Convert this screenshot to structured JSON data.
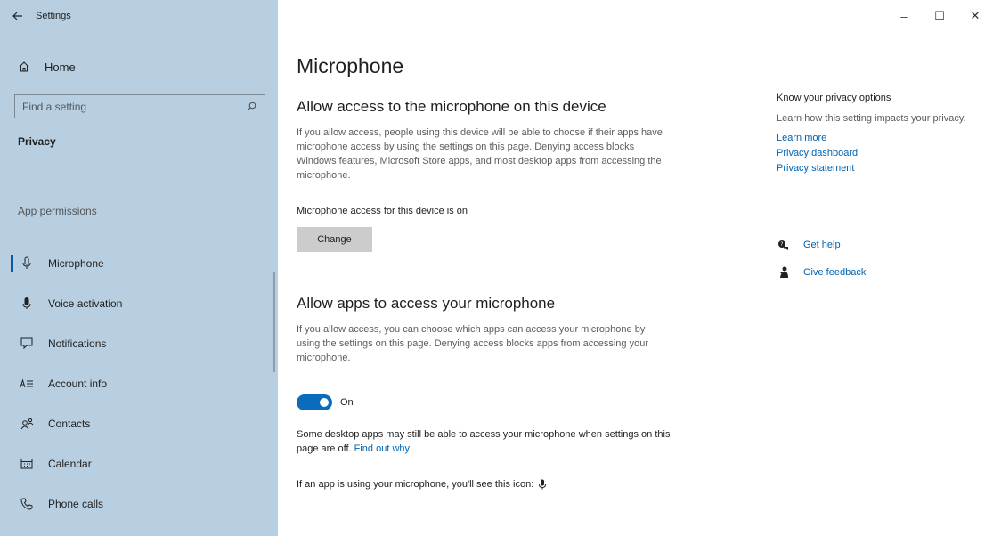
{
  "window": {
    "title": "Settings",
    "minimize_glyph": "–",
    "maximize_glyph": "☐",
    "close_glyph": "✕"
  },
  "sidebar": {
    "home_label": "Home",
    "search_placeholder": "Find a setting",
    "section_privacy": "Privacy",
    "section_app_permissions": "App permissions",
    "items": [
      {
        "label": "Microphone",
        "icon": "microphone-icon",
        "active": true
      },
      {
        "label": "Voice activation",
        "icon": "voice-activation-icon",
        "active": false
      },
      {
        "label": "Notifications",
        "icon": "notifications-icon",
        "active": false
      },
      {
        "label": "Account info",
        "icon": "account-info-icon",
        "active": false
      },
      {
        "label": "Contacts",
        "icon": "contacts-icon",
        "active": false
      },
      {
        "label": "Calendar",
        "icon": "calendar-icon",
        "active": false
      },
      {
        "label": "Phone calls",
        "icon": "phone-calls-icon",
        "active": false
      }
    ]
  },
  "main": {
    "title": "Microphone",
    "device_heading": "Allow access to the microphone on this device",
    "device_desc": "If you allow access, people using this device will be able to choose if their apps have microphone access by using the settings on this page. Denying access blocks Windows features, Microsoft Store apps, and most desktop apps from accessing the microphone.",
    "device_status": "Microphone access for this device is on",
    "change_button": "Change",
    "apps_heading": "Allow apps to access your microphone",
    "apps_desc": "If you allow access, you can choose which apps can access your microphone by using the settings on this page. Denying access blocks apps from accessing your microphone.",
    "toggle_state": "On",
    "desktop_note": "Some desktop apps may still be able to access your microphone when settings on this page are off.",
    "find_out_why": "Find out why",
    "icon_note": "If an app is using your microphone, you'll see this icon:"
  },
  "side_panel": {
    "title": "Know your privacy options",
    "desc": "Learn how this setting impacts your privacy.",
    "links": [
      "Learn more",
      "Privacy dashboard",
      "Privacy statement"
    ],
    "get_help": "Get help",
    "give_feedback": "Give feedback"
  },
  "colors": {
    "sidebar_bg": "#b7cfe0",
    "accent": "#0b6cbd",
    "link": "#0063b1",
    "button_bg": "#cccccc"
  }
}
